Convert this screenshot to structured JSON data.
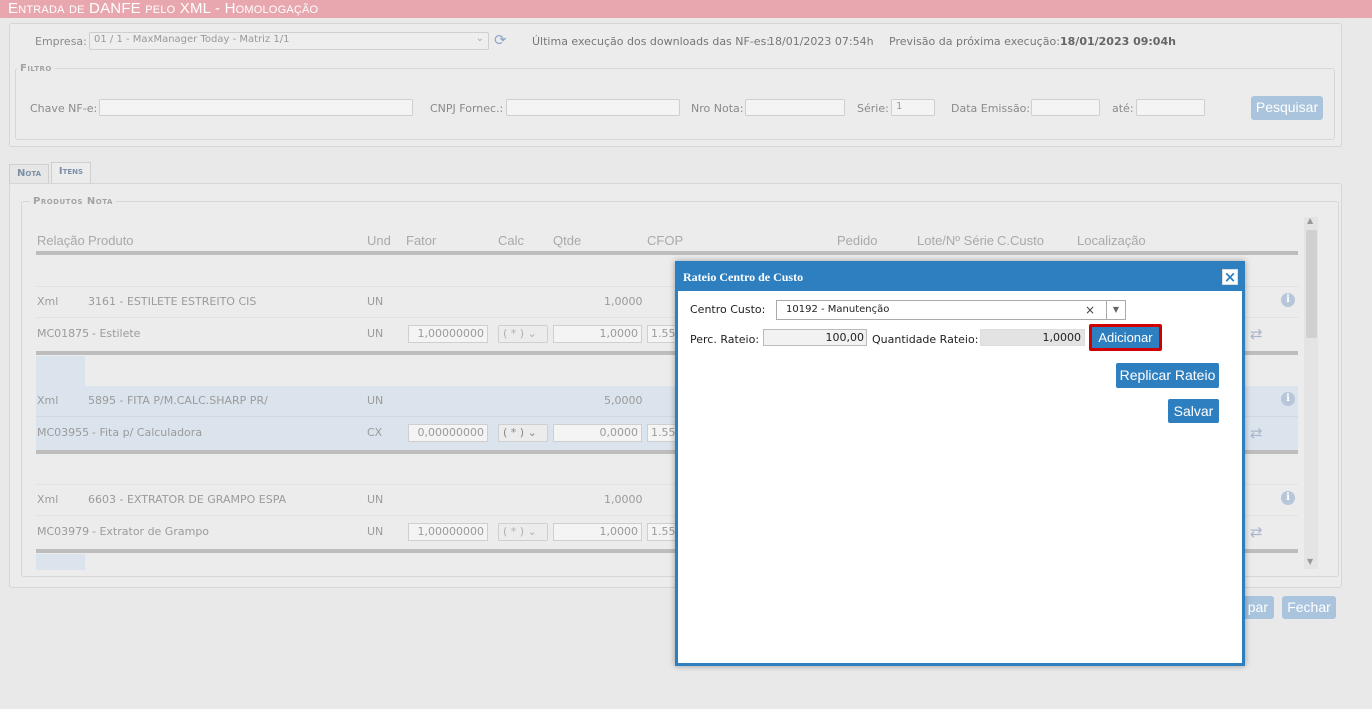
{
  "title": "Entrada de DANFE pelo XML  - Homologação",
  "top": {
    "empresa_label": "Empresa:",
    "empresa_value": "01 / 1 - MaxManager Today - Matriz 1/1",
    "ultima_label": "Última execução dos downloads das NF-es:",
    "ultima_value": "18/01/2023 07:54h",
    "previsao_label": "Previsão da próxima execução:",
    "previsao_value": "18/01/2023 09:04h"
  },
  "filtro": {
    "legend": "Filtro",
    "chave_label": "Chave NF-e:",
    "cnpj_label": "CNPJ Fornec.:",
    "nro_label": "Nro Nota:",
    "serie_label": "Série:",
    "serie_value": "1",
    "data_label": "Data Emissão:",
    "ate_label": "até:",
    "pesquisar_label": "Pesquisar"
  },
  "tabs": [
    {
      "label": "Nota"
    },
    {
      "label": "Itens"
    }
  ],
  "produtos": {
    "legend": "Produtos Nota",
    "headers": [
      "Relação",
      "Produto",
      "Und",
      "Fator",
      "Calc",
      "Qtde",
      "CFOP",
      "Pedido",
      "Lote/Nº Série",
      "C.Custo",
      "Localização"
    ],
    "items": [
      {
        "xml": {
          "rel": "Xml",
          "produto": "3161 - ESTILETE ESTREITO CIS",
          "und": "UN",
          "qtde": "1,0000"
        },
        "mc": {
          "rel": "MC01875",
          "produto": "- Estilete",
          "und": "UN",
          "fator": "1,00000000",
          "calc": "( * )",
          "qtde": "1,0000",
          "cfop": "1.55"
        }
      },
      {
        "xml": {
          "rel": "Xml",
          "produto": "5895 - FITA P/M.CALC.SHARP PR/",
          "und": "UN",
          "qtde": "5,0000"
        },
        "mc": {
          "rel": "MC03955",
          "produto": "- Fita p/ Calculadora",
          "und": "CX",
          "fator": "0,00000000",
          "calc": "( * )",
          "qtde": "0,0000",
          "cfop": "1.55"
        }
      },
      {
        "xml": {
          "rel": "Xml",
          "produto": "6603 - EXTRATOR DE GRAMPO ESPA",
          "und": "UN",
          "qtde": "1,0000"
        },
        "mc": {
          "rel": "MC03979",
          "produto": "- Extrator de Grampo",
          "und": "UN",
          "fator": "1,00000000",
          "calc": "( * )",
          "qtde": "1,0000",
          "cfop": "1.55"
        }
      }
    ]
  },
  "bottom_buttons": {
    "partial": "par",
    "fechar": "Fechar"
  },
  "modal": {
    "title": "Rateio Centro de Custo",
    "close": "×",
    "centro_label": "Centro Custo:",
    "centro_value": "10192 - Manutenção",
    "centro_clear": "×",
    "perc_label": "Perc. Rateio:",
    "perc_value": "100,00",
    "qtd_label": "Quantidade Rateio:",
    "qtd_value": "1,0000",
    "adicionar": "Adicionar",
    "replicar": "Replicar Rateio",
    "salvar": "Salvar"
  },
  "colors": {
    "accent": "#2d7fc0",
    "title_bar": "#e8a7ae",
    "highlight": "#cc0000"
  }
}
